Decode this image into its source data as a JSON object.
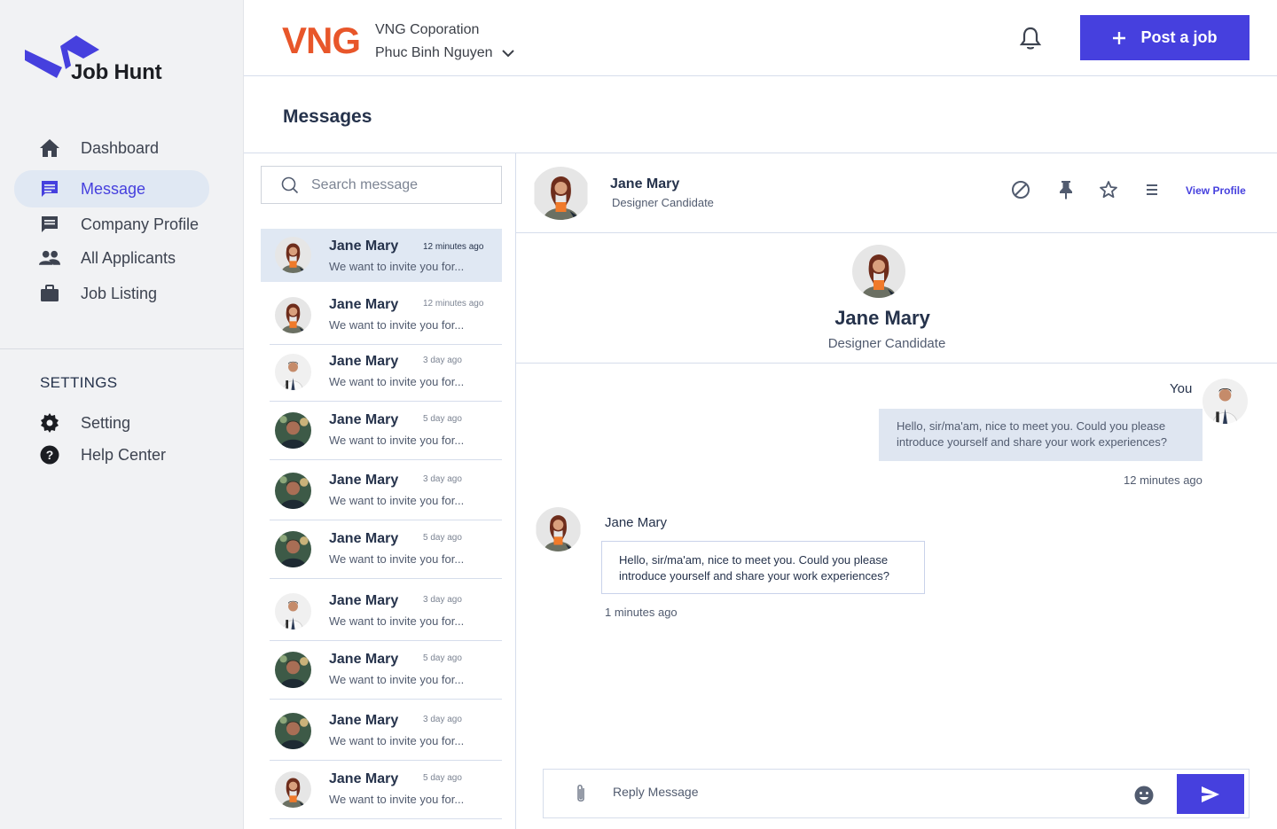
{
  "brand": {
    "name": "Job Hunt",
    "accent": "#4640de"
  },
  "sidebar": {
    "items": [
      {
        "label": "Dashboard",
        "icon": "home-icon"
      },
      {
        "label": "Message",
        "icon": "message-icon",
        "active": true
      },
      {
        "label": "Company Profile",
        "icon": "company-icon"
      },
      {
        "label": "All Applicants",
        "icon": "people-icon"
      },
      {
        "label": "Job Listing",
        "icon": "briefcase-icon"
      }
    ],
    "settings_title": "SETTINGS",
    "settings_items": [
      {
        "label": "Setting",
        "icon": "gear-icon"
      },
      {
        "label": "Help Center",
        "icon": "help-icon"
      }
    ]
  },
  "header": {
    "company_logo_text": "VNG",
    "company_name": "VNG Coporation",
    "user_name": "Phuc Binh Nguyen",
    "post_job_label": "Post a job"
  },
  "page": {
    "title": "Messages"
  },
  "search": {
    "placeholder": "Search message"
  },
  "conversations": [
    {
      "name": "Jane Mary",
      "time": "12 minutes ago",
      "preview": "We want to invite you for...",
      "avatar": "woman"
    },
    {
      "name": "Jane Mary",
      "time": "12 minutes ago",
      "preview": "We want to invite you for...",
      "avatar": "woman"
    },
    {
      "name": "Jane Mary",
      "time": "3 day ago",
      "preview": "We want to invite you for...",
      "avatar": "man-suit"
    },
    {
      "name": "Jane Mary",
      "time": "5 day ago",
      "preview": "We want to invite you for...",
      "avatar": "man-dark"
    },
    {
      "name": "Jane Mary",
      "time": "3 day ago",
      "preview": "We want to invite you for...",
      "avatar": "man-dark"
    },
    {
      "name": "Jane Mary",
      "time": "5 day ago",
      "preview": "We want to invite you for...",
      "avatar": "man-dark"
    },
    {
      "name": "Jane Mary",
      "time": "3 day ago",
      "preview": "We want to invite you for...",
      "avatar": "man-suit"
    },
    {
      "name": "Jane Mary",
      "time": "5 day ago",
      "preview": "We want to invite you for...",
      "avatar": "man-dark"
    },
    {
      "name": "Jane Mary",
      "time": "3 day ago",
      "preview": "We want to invite you for...",
      "avatar": "man-dark"
    },
    {
      "name": "Jane Mary",
      "time": "5 day ago",
      "preview": "We want to invite you for...",
      "avatar": "woman"
    }
  ],
  "chat": {
    "contact_name": "Jane Mary",
    "contact_role": "Designer Candidate",
    "view_profile_label": "View Profile",
    "header_icons": [
      "block-icon",
      "pin-icon",
      "star-icon",
      "menu-icon"
    ],
    "you_label": "You",
    "outgoing": {
      "text": "Hello, sir/ma'am, nice to meet you. Could you please introduce yourself and share your work experiences?",
      "time": "12 minutes ago"
    },
    "incoming": {
      "sender": "Jane Mary",
      "text": "Hello, sir/ma'am, nice to meet you. Could you please introduce yourself and share your work experiences?",
      "time": "1 minutes ago"
    },
    "reply_placeholder": "Reply Message"
  }
}
